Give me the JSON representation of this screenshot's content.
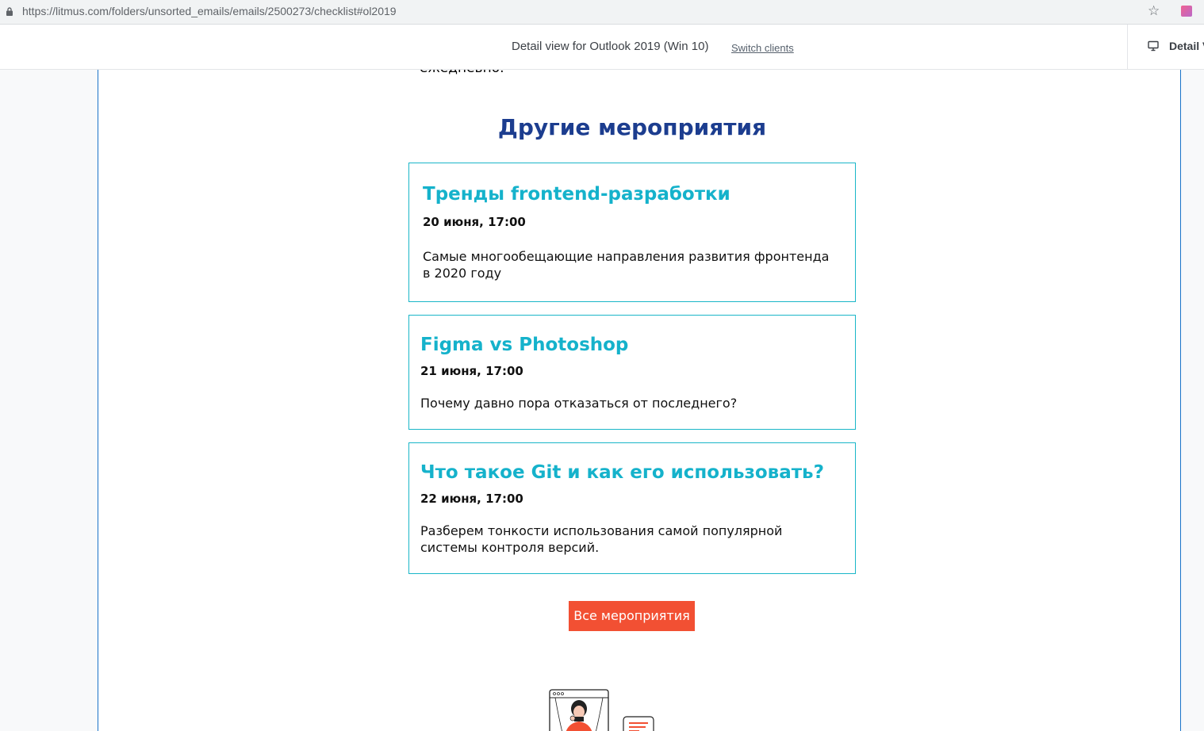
{
  "browser": {
    "url": "https://litmus.com/folders/unsorted_emails/emails/2500273/checklist#ol2019",
    "icons": [
      "lock-icon",
      "star-icon",
      "extension-icon"
    ]
  },
  "header": {
    "detail_title": "Detail view for Outlook 2019 (Win 10)",
    "switch_label": "Switch clients",
    "detail_right": "Detail V",
    "icons": [
      "monitor-icon"
    ]
  },
  "email": {
    "prev_text": "ежедневно.",
    "section_title": "Другие мероприятия",
    "events": [
      {
        "title": "Тренды frontend-разработки",
        "date": "20 июня, 17:00",
        "desc": "Самые многообещающие направления развития фронтенда в 2020 году"
      },
      {
        "title": "Figma vs Photoshop",
        "date": "21 июня, 17:00",
        "desc": "Почему давно пора отказаться от последнего?"
      },
      {
        "title": "Что такое Git и как его использовать?",
        "date": "22 июня, 17:00",
        "desc": "Разберем тонкости использования самой популярной системы контроля версий."
      }
    ],
    "cta_label": "Все мероприятия"
  },
  "colors": {
    "title_blue": "#1c3d8f",
    "event_cyan": "#15b2cb",
    "cta_red": "#f25033",
    "frame_blue": "#1a73c8"
  }
}
